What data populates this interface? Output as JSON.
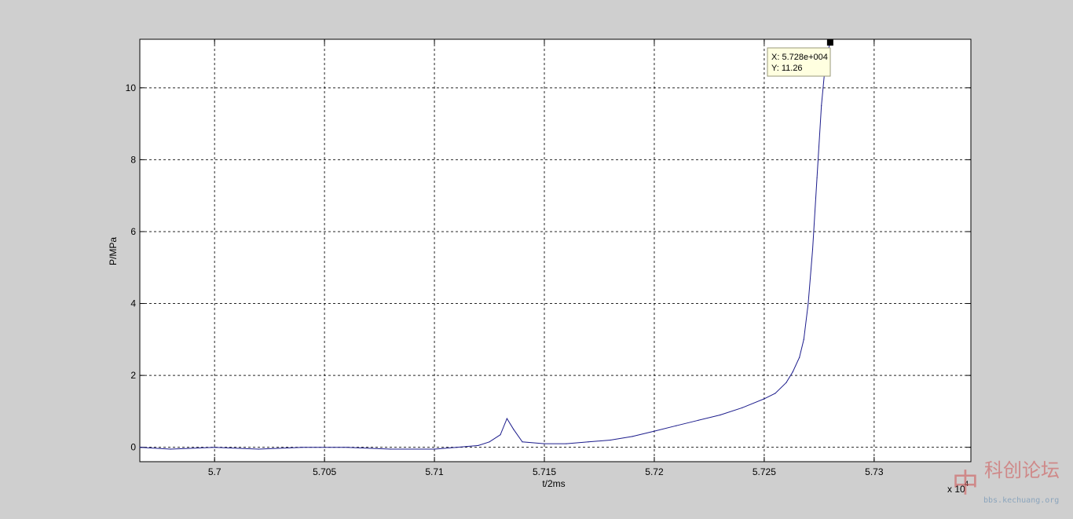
{
  "chart_data": {
    "type": "line",
    "title": "",
    "xlabel": "t/2ms",
    "ylabel": "P/MPa",
    "xlim": [
      5.6966,
      5.7344
    ],
    "ylim": [
      -0.4,
      11.35
    ],
    "x_multiplier_label": "x 10",
    "x_multiplier_exp": "4",
    "xticks": [
      5.7,
      5.705,
      5.71,
      5.715,
      5.72,
      5.725,
      5.73
    ],
    "xtick_labels": [
      "5.7",
      "5.705",
      "5.71",
      "5.715",
      "5.72",
      "5.725",
      "5.73"
    ],
    "yticks": [
      0,
      2,
      4,
      6,
      8,
      10
    ],
    "ytick_labels": [
      "0",
      "2",
      "4",
      "6",
      "8",
      "10"
    ],
    "grid": true,
    "series": [
      {
        "color": "#1c1c8c",
        "x": [
          5.6966,
          5.698,
          5.7,
          5.702,
          5.704,
          5.706,
          5.708,
          5.71,
          5.711,
          5.712,
          5.7125,
          5.713,
          5.7133,
          5.7136,
          5.714,
          5.715,
          5.716,
          5.717,
          5.718,
          5.719,
          5.72,
          5.721,
          5.722,
          5.723,
          5.724,
          5.725,
          5.7255,
          5.726,
          5.7263,
          5.7266,
          5.7268,
          5.727,
          5.7272,
          5.7274,
          5.7276,
          5.7278,
          5.728
        ],
        "y": [
          0.0,
          -0.05,
          0.0,
          -0.05,
          0.0,
          0.0,
          -0.05,
          -0.05,
          0.0,
          0.05,
          0.15,
          0.35,
          0.8,
          0.5,
          0.15,
          0.1,
          0.1,
          0.15,
          0.2,
          0.3,
          0.45,
          0.6,
          0.75,
          0.9,
          1.1,
          1.35,
          1.5,
          1.8,
          2.1,
          2.5,
          3.0,
          4.0,
          5.5,
          7.5,
          9.5,
          10.8,
          11.26
        ]
      }
    ],
    "datatip": {
      "x_text": "X: 5.728e+004",
      "y_text": "Y: 11.26"
    }
  },
  "watermark": {
    "title": "科创论坛",
    "url": "bbs.kechuang.org"
  }
}
